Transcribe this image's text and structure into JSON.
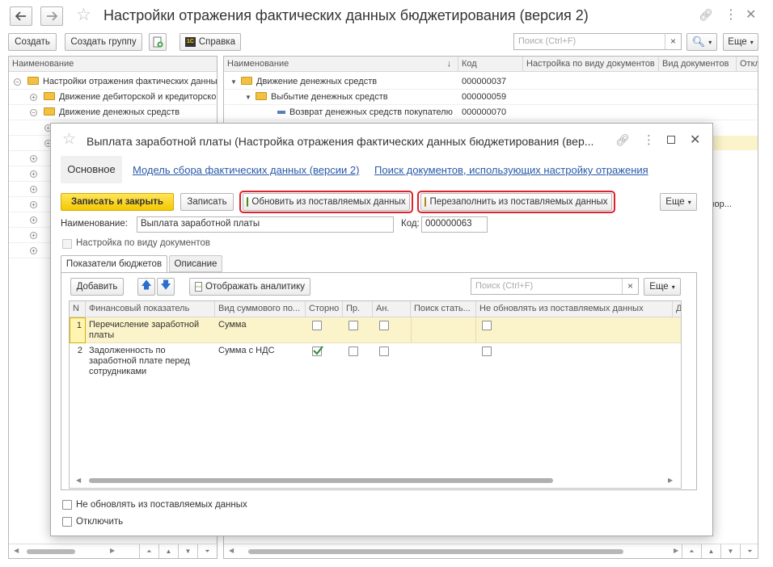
{
  "window": {
    "title": "Настройки отражения фактических данных бюджетирования (версия 2)"
  },
  "toolbar": {
    "create": "Создать",
    "create_group": "Создать группу",
    "help": "Справка",
    "search_placeholder": "Поиск (Ctrl+F)",
    "more": "Еще"
  },
  "left_tree": {
    "header": "Наименование",
    "rows": [
      "Настройки отражения фактических данных",
      "Движение дебиторской и кредиторской",
      "Движение денежных средств"
    ]
  },
  "right_list": {
    "headers": [
      "Наименование",
      "Код",
      "Настройка по виду документов",
      "Вид документов",
      "Откл"
    ],
    "rows": [
      {
        "name": "Движение денежных средств",
        "code": "000000037"
      },
      {
        "name": "Выбытие денежных средств",
        "code": "000000059"
      },
      {
        "name": "Возврат денежных средств покупателю",
        "code": "000000070"
      }
    ],
    "partial_text": "лор..."
  },
  "dialog": {
    "title": "Выплата  заработной платы (Настройка отражения фактических данных бюджетирования (вер...",
    "tabs": {
      "main": "Основное",
      "model_link": "Модель сбора фактических данных (версии 2)",
      "search_link": "Поиск документов, использующих настройку отражения"
    },
    "buttons": {
      "save_close": "Записать и закрыть",
      "save": "Записать",
      "update": "Обновить из поставляемых данных",
      "refill": "Перезаполнить из поставляемых данных",
      "more": "Еще"
    },
    "name_label": "Наименование:",
    "name_value": "Выплата  заработной платы",
    "code_label": "Код:",
    "code_value": "000000063",
    "by_doc_type": "Настройка по виду документов",
    "inner_tabs": [
      "Показатели бюджетов",
      "Описание"
    ],
    "inner_toolbar": {
      "add": "Добавить",
      "show_analytics": "Отображать аналитику",
      "search_placeholder": "Поиск (Ctrl+F)",
      "more": "Еще"
    },
    "table": {
      "headers": [
        "N",
        "Финансовый показатель",
        "Вид суммового по...",
        "Сторно",
        "Пр.",
        "Ан.",
        "Поиск стать...",
        "Не обновлять из поставляемых данных",
        "Д"
      ],
      "rows": [
        {
          "n": "1",
          "indicator": "Перечисление заработной платы",
          "sum_type": "Сумма",
          "storno": false
        },
        {
          "n": "2",
          "indicator": "Задолженность по заработной плате перед сотрудниками",
          "sum_type": "Сумма с НДС",
          "storno": true
        }
      ]
    },
    "no_update": "Не обновлять из поставляемых данных",
    "disable": "Отключить"
  },
  "colors": {
    "accent_yellow": "#f5c800",
    "highlight_row": "#fbf3c9",
    "link": "#2a5aa8",
    "red_outline": "#e0202a"
  }
}
